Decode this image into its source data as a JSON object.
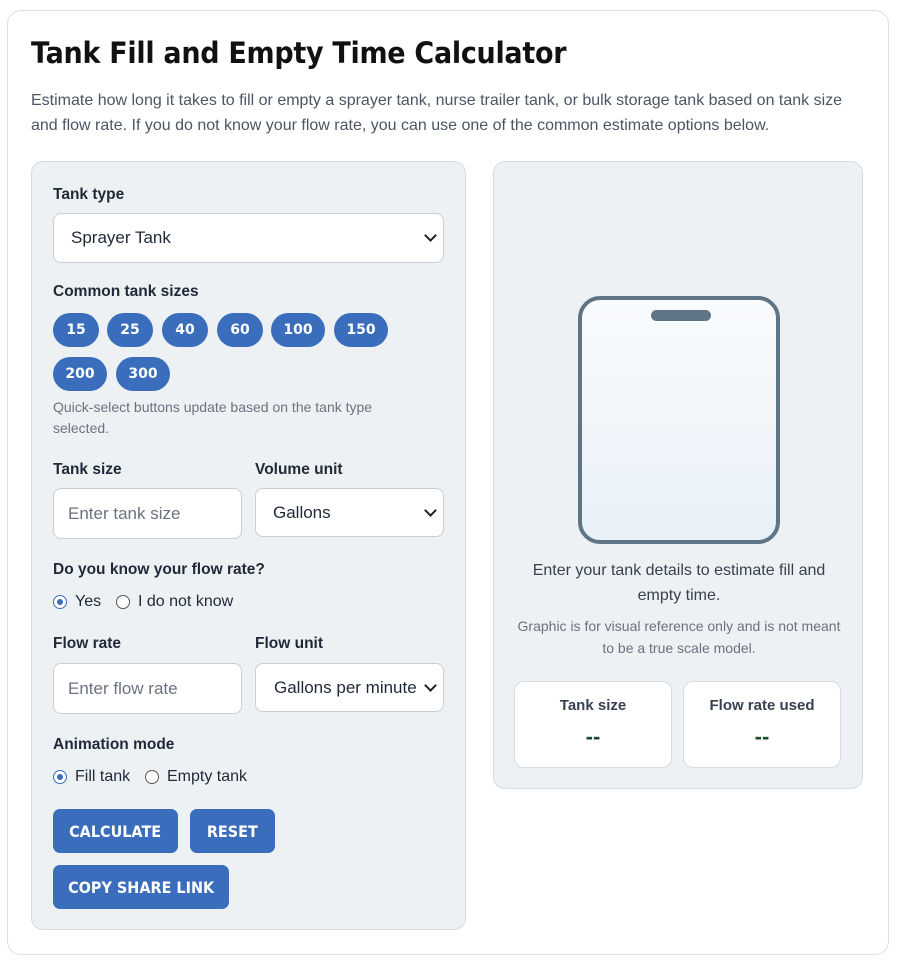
{
  "header": {
    "title": "Tank Fill and Empty Time Calculator",
    "intro": "Estimate how long it takes to fill or empty a sprayer tank, nurse trailer tank, or bulk storage tank based on tank size and flow rate. If you do not know your flow rate, you can use one of the common estimate options below."
  },
  "form": {
    "tank_type_label": "Tank type",
    "tank_type_value": "Sprayer Tank",
    "common_sizes_label": "Common tank sizes",
    "common_sizes": [
      "15",
      "25",
      "40",
      "60",
      "100",
      "150",
      "200",
      "300"
    ],
    "sizes_hint": "Quick-select buttons update based on the tank type selected.",
    "tank_size_label": "Tank size",
    "tank_size_placeholder": "Enter tank size",
    "volume_unit_label": "Volume unit",
    "volume_unit_value": "Gallons",
    "know_flow_label": "Do you know your flow rate?",
    "know_flow_options": [
      "Yes",
      "I do not know"
    ],
    "know_flow_selected": "Yes",
    "flow_rate_label": "Flow rate",
    "flow_rate_placeholder": "Enter flow rate",
    "flow_unit_label": "Flow unit",
    "flow_unit_value": "Gallons per minute",
    "animation_label": "Animation mode",
    "animation_options": [
      "Fill tank",
      "Empty tank"
    ],
    "animation_selected": "Fill tank",
    "calculate_label": "CALCULATE",
    "reset_label": "RESET",
    "share_label": "COPY SHARE LINK"
  },
  "result": {
    "status": "Enter your tank details to estimate fill and empty time.",
    "note": "Graphic is for visual reference only and is not meant to be a true scale model.",
    "tank_size_title": "Tank size",
    "tank_size_value": "--",
    "flow_rate_title": "Flow rate used",
    "flow_rate_value": "--"
  },
  "colors": {
    "accent": "#3a6dbb",
    "panel": "#edf1f4",
    "tank_outline": "#5f7585",
    "stat_value": "#1e4a2c"
  }
}
